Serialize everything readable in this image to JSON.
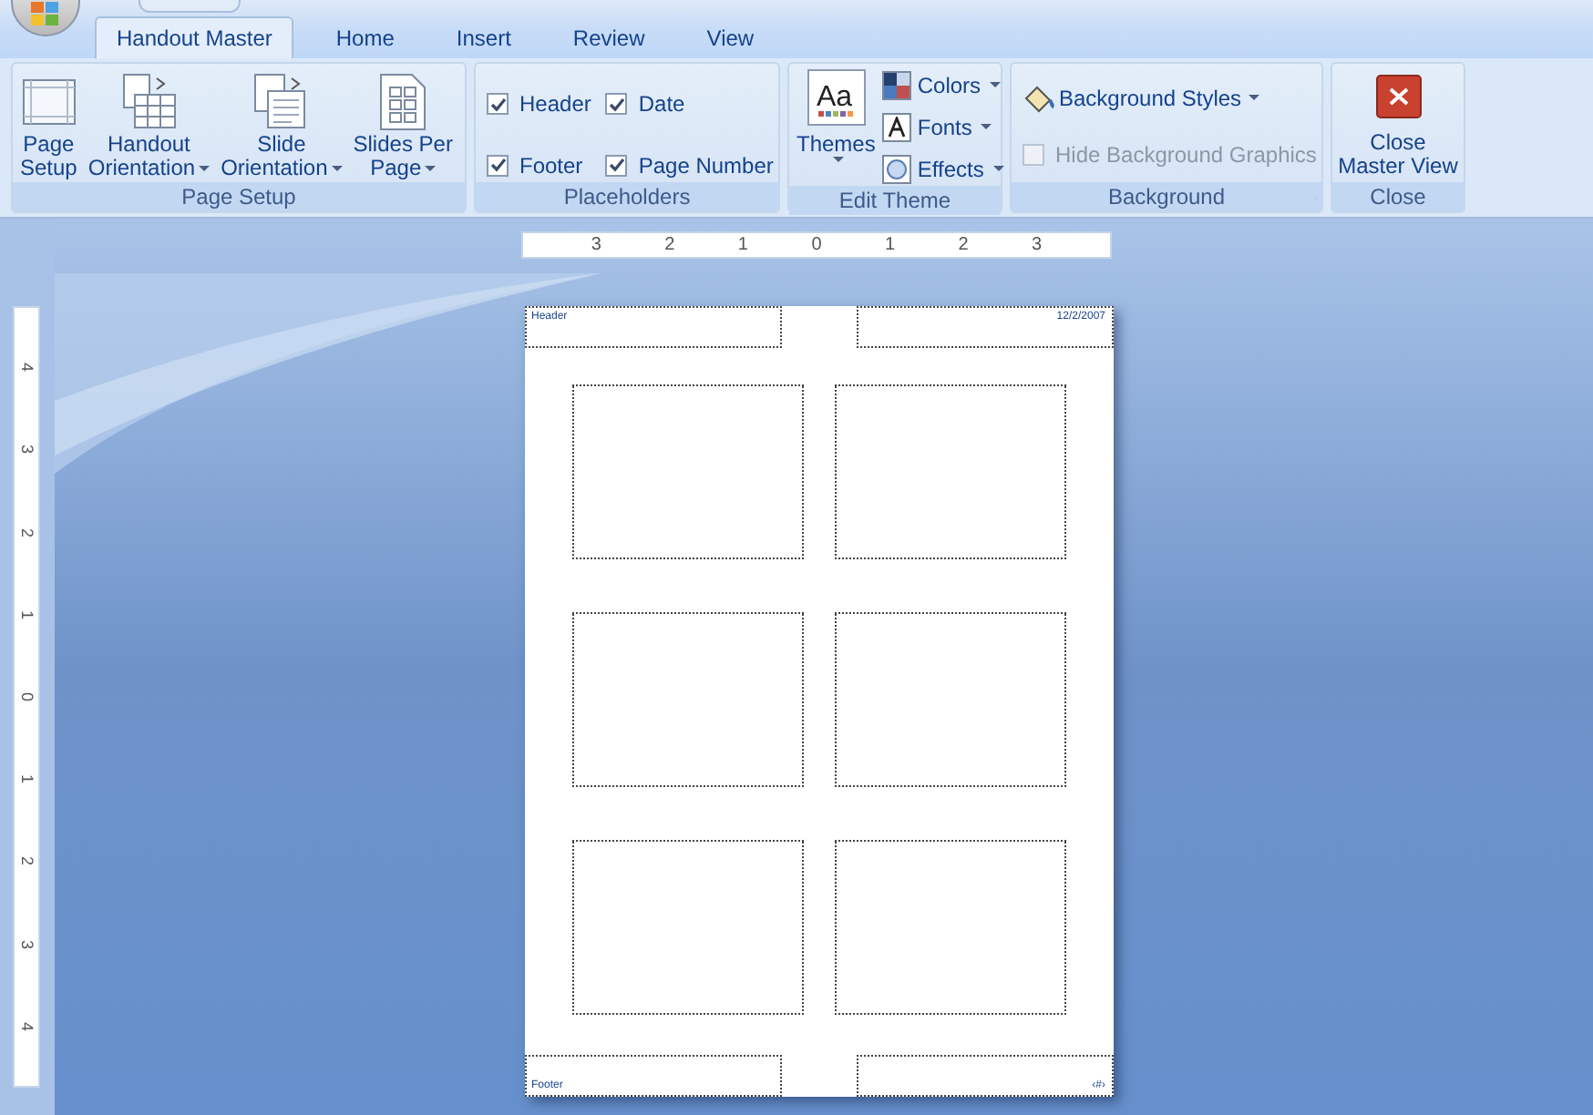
{
  "tabs": [
    {
      "label": "Handout Master",
      "selected": true
    },
    {
      "label": "Home",
      "selected": false
    },
    {
      "label": "Insert",
      "selected": false
    },
    {
      "label": "Review",
      "selected": false
    },
    {
      "label": "View",
      "selected": false
    }
  ],
  "page_setup": {
    "name": "Page Setup",
    "buttons": [
      {
        "lines": [
          "Page",
          "Setup"
        ],
        "dropdown": false
      },
      {
        "lines": [
          "Handout",
          "Orientation"
        ],
        "dropdown": true
      },
      {
        "lines": [
          "Slide",
          "Orientation"
        ],
        "dropdown": true
      },
      {
        "lines": [
          "Slides Per",
          "Page"
        ],
        "dropdown": true
      }
    ]
  },
  "placeholders": {
    "name": "Placeholders",
    "items": [
      {
        "label": "Header",
        "checked": true
      },
      {
        "label": "Date",
        "checked": true
      },
      {
        "label": "Footer",
        "checked": true
      },
      {
        "label": "Page Number",
        "checked": true
      }
    ]
  },
  "edit_theme": {
    "name": "Edit Theme",
    "themes": "Themes",
    "themes_sample": "Aa",
    "items": [
      {
        "label": "Colors"
      },
      {
        "label": "Fonts"
      },
      {
        "label": "Effects"
      }
    ]
  },
  "background": {
    "name": "Background",
    "styles": "Background Styles",
    "hide": {
      "label": "Hide Background Graphics",
      "checked": false,
      "disabled": true
    }
  },
  "close": {
    "name": "Close",
    "lines": [
      "Close",
      "Master View"
    ]
  },
  "hruler": [
    "3",
    "2",
    "1",
    "0",
    "1",
    "2",
    "3"
  ],
  "vruler": [
    "4",
    "3",
    "2",
    "1",
    "0",
    "1",
    "2",
    "3",
    "4"
  ],
  "page": {
    "header": "Header",
    "date": "12/2/2007",
    "footer": "Footer",
    "page_number": "‹#›"
  }
}
